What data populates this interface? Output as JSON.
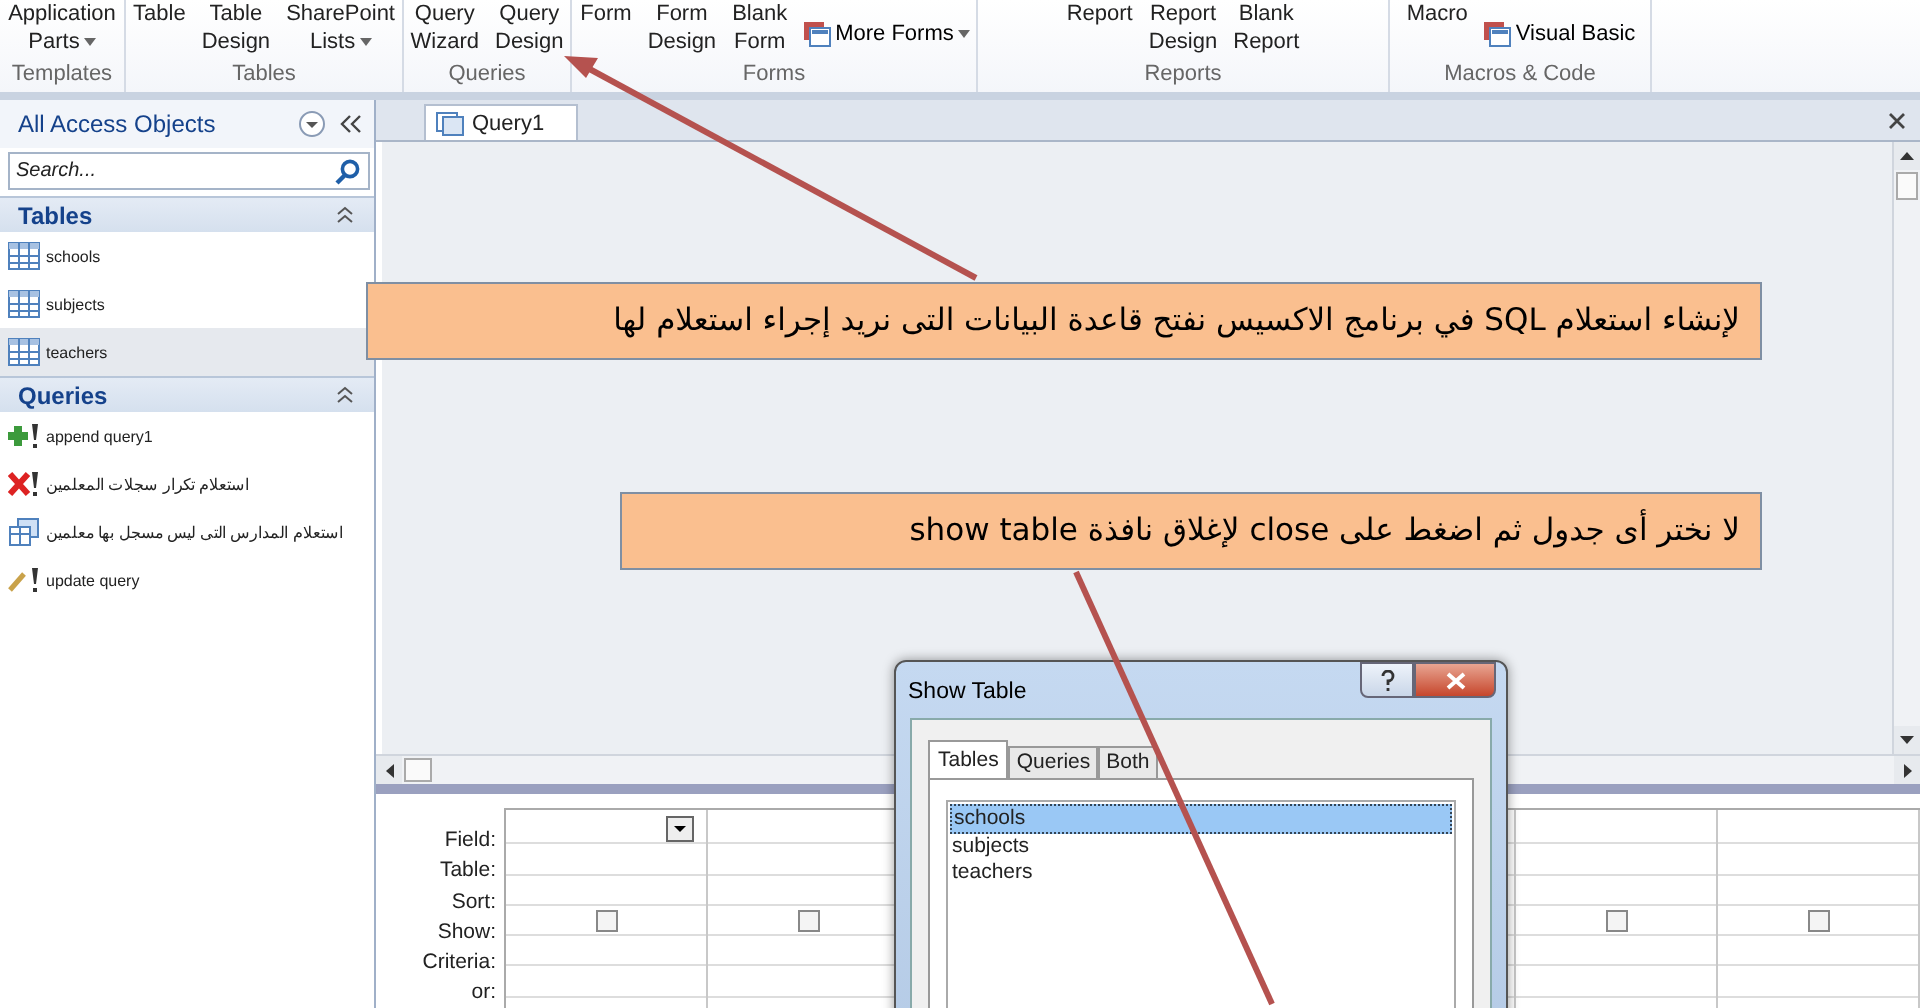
{
  "ribbon": {
    "groups": [
      {
        "label": "Templates",
        "items": [
          {
            "kind": "large",
            "lines": [
              "Application",
              "Parts"
            ],
            "dropdown": true
          }
        ]
      },
      {
        "label": "Tables",
        "items": [
          {
            "kind": "large",
            "lines": [
              "Table"
            ],
            "dropdown": false
          },
          {
            "kind": "large",
            "lines": [
              "Table",
              "Design"
            ],
            "dropdown": false
          },
          {
            "kind": "large",
            "lines": [
              "SharePoint",
              "Lists"
            ],
            "dropdown": true
          }
        ]
      },
      {
        "label": "Queries",
        "items": [
          {
            "kind": "large",
            "lines": [
              "Query",
              "Wizard"
            ],
            "dropdown": false
          },
          {
            "kind": "large",
            "lines": [
              "Query",
              "Design"
            ],
            "dropdown": false
          }
        ]
      },
      {
        "label": "Forms",
        "items": [
          {
            "kind": "large",
            "lines": [
              "Form"
            ],
            "dropdown": false
          },
          {
            "kind": "large",
            "lines": [
              "Form",
              "Design"
            ],
            "dropdown": false
          },
          {
            "kind": "large",
            "lines": [
              "Blank",
              "Form"
            ],
            "dropdown": false
          },
          {
            "kind": "small",
            "lines": [
              "More Forms"
            ],
            "dropdown": true
          }
        ]
      },
      {
        "label": "Reports",
        "items": [
          {
            "kind": "large",
            "lines": [
              "Report"
            ],
            "dropdown": false
          },
          {
            "kind": "large",
            "lines": [
              "Report",
              "Design"
            ],
            "dropdown": false
          },
          {
            "kind": "large",
            "lines": [
              "Blank",
              "Report"
            ],
            "dropdown": false
          }
        ]
      },
      {
        "label": "Macros & Code",
        "items": [
          {
            "kind": "large",
            "lines": [
              "Macro"
            ],
            "dropdown": false
          },
          {
            "kind": "small",
            "lines": [
              "Visual Basic"
            ],
            "dropdown": false
          }
        ]
      }
    ]
  },
  "navigation": {
    "title": "All Access Objects",
    "search": {
      "placeholder": "Search..."
    },
    "sections": [
      {
        "title": "Tables",
        "items": [
          {
            "kind": "table",
            "label": "schools",
            "selected": false
          },
          {
            "kind": "table",
            "label": "subjects",
            "selected": false
          },
          {
            "kind": "table",
            "label": "teachers",
            "selected": true
          }
        ]
      },
      {
        "title": "Queries",
        "items": [
          {
            "kind": "append",
            "label": "append query1",
            "selected": false
          },
          {
            "kind": "delete",
            "label": "استعلام تكرار سجلات  المعلمين",
            "selected": false
          },
          {
            "kind": "make-table",
            "label": "استعلام المدارس التى ليس مسجل بها معلمين",
            "selected": false
          },
          {
            "kind": "update",
            "label": "update query",
            "selected": false
          }
        ]
      }
    ]
  },
  "document": {
    "tabs": [
      {
        "label": "Query1",
        "selected": true
      }
    ],
    "grid": {
      "row_labels": [
        "Field:",
        "Table:",
        "Sort:",
        "Show:",
        "Criteria:",
        "or:"
      ],
      "columns": [
        {
          "active": true,
          "checked": false
        },
        {
          "active": false,
          "checked": false
        },
        {},
        {},
        {},
        {
          "active": false,
          "checked": false
        },
        {
          "active": false,
          "checked": false
        }
      ]
    }
  },
  "show_table_dialog": {
    "title": "Show Table",
    "tabs": [
      {
        "label": "Tables",
        "selected": true
      },
      {
        "label": "Queries",
        "selected": false
      },
      {
        "label": "Both",
        "selected": false
      }
    ],
    "items": [
      {
        "label": "schools",
        "selected": true
      },
      {
        "label": "subjects",
        "selected": false
      },
      {
        "label": "teachers",
        "selected": false
      }
    ]
  },
  "annotations": [
    {
      "text": "لإنشاء استعلام SQL في برنامج الاكسيس نفتح قاعدة البيانات التى نريد إجراء استعلام لها"
    },
    {
      "text": "لا نختر أى جدول ثم اضغط على close لإغلاق نافذة  show table"
    }
  ]
}
